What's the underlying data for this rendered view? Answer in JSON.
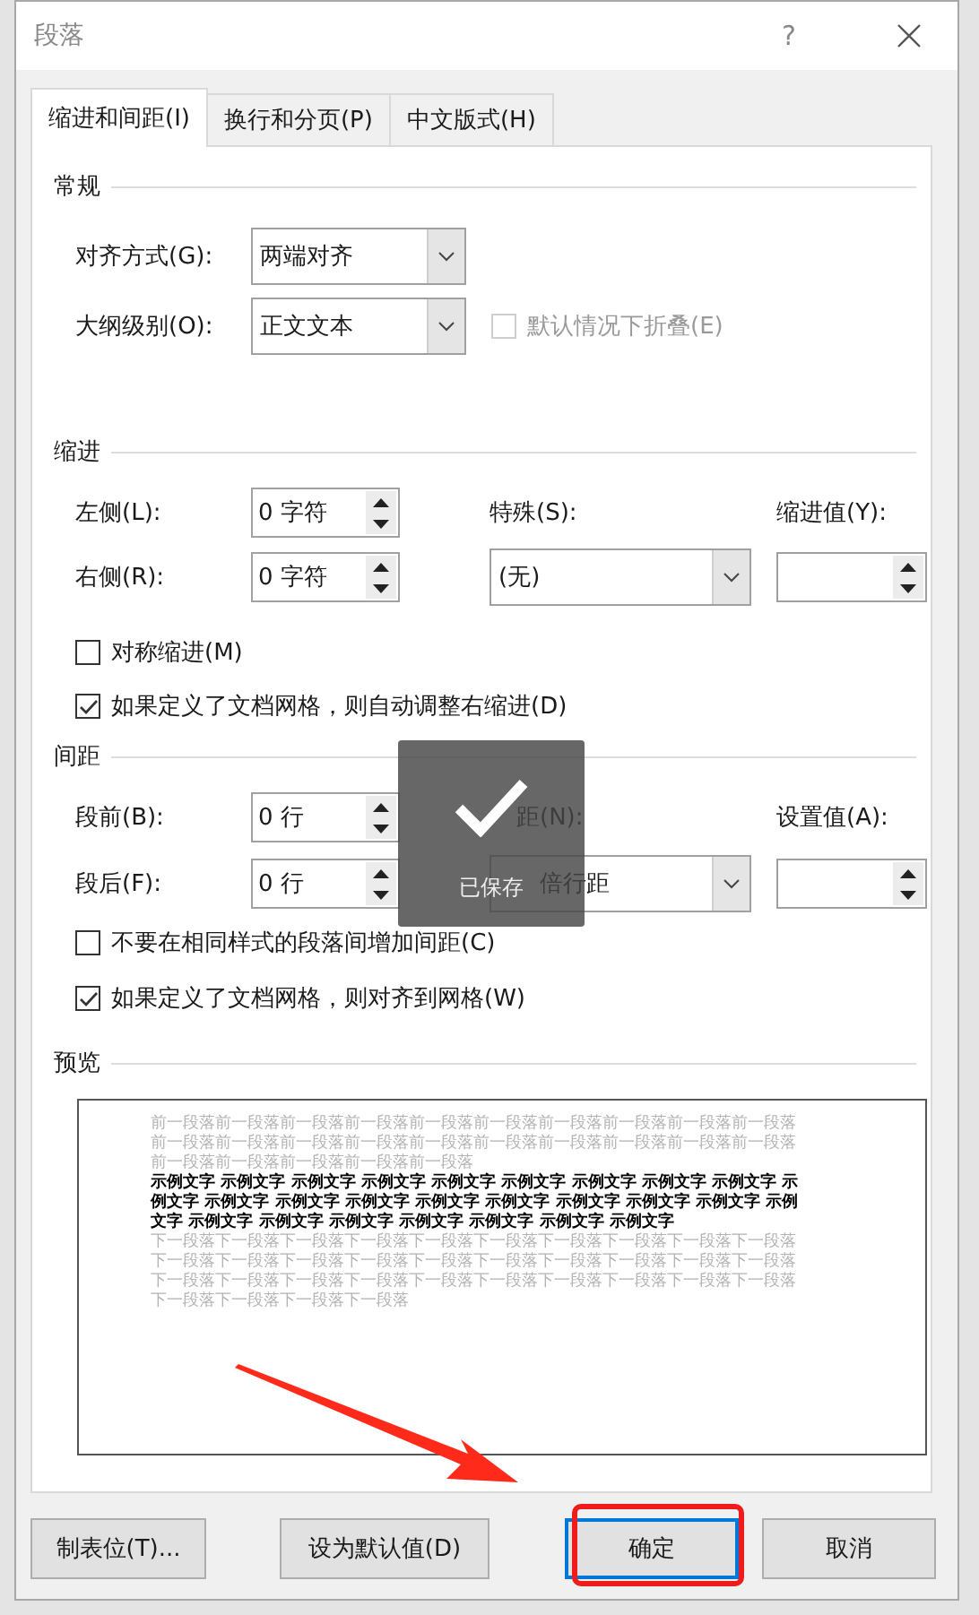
{
  "dialog": {
    "title": "段落",
    "help": "?"
  },
  "tabs": [
    {
      "label": "缩进和间距(I)",
      "selected": true
    },
    {
      "label": "换行和分页(P)",
      "selected": false
    },
    {
      "label": "中文版式(H)",
      "selected": false
    }
  ],
  "general": {
    "heading": "常规",
    "alignment": {
      "label": "对齐方式(G):",
      "value": "两端对齐"
    },
    "outline_level": {
      "label": "大纲级别(O):",
      "value": "正文文本"
    },
    "collapse": {
      "label": "默认情况下折叠(E)",
      "checked": false,
      "disabled": true
    }
  },
  "indent": {
    "heading": "缩进",
    "left": {
      "label": "左侧(L):",
      "value": "0 字符"
    },
    "right": {
      "label": "右侧(R):",
      "value": "0 字符"
    },
    "special": {
      "label": "特殊(S):",
      "value": "(无)"
    },
    "by": {
      "label": "缩进值(Y):"
    },
    "checkboxes": [
      {
        "label": "对称缩进(M)",
        "checked": false
      },
      {
        "label": "如果定义了文档网格，则自动调整右缩进(D)",
        "checked": true
      }
    ]
  },
  "spacing": {
    "heading": "间距",
    "before": {
      "label": "段前(B):",
      "value": "0 行"
    },
    "after": {
      "label": "段后(F):",
      "value": "0 行"
    },
    "line_spacing": {
      "label": "距(N):",
      "value": "倍行距"
    },
    "at": {
      "label": "设置值(A):"
    },
    "checkboxes": [
      {
        "label": "不要在相同样式的段落间增加间距(C)",
        "checked": false
      },
      {
        "label": "如果定义了文档网格，则对齐到网格(W)",
        "checked": true
      }
    ]
  },
  "preview": {
    "heading": "预览",
    "previous_text": "前一段落前一段落前一段落前一段落前一段落前一段落前一段落前一段落前一段落前一段落前一段落前一段落前一段落前一段落前一段落前一段落前一段落前一段落前一段落前一段落前一段落前一段落前一段落前一段落前一段落",
    "sample_text": "示例文字 示例文字 示例文字 示例文字 示例文字 示例文字 示例文字 示例文字 示例文字 示例文字 示例文字 示例文字 示例文字 示例文字 示例文字 示例文字 示例文字 示例文字 示例文字 示例文字 示例文字 示例文字 示例文字 示例文字 示例文字 示例文字",
    "next_text": "下一段落下一段落下一段落下一段落下一段落下一段落下一段落下一段落下一段落下一段落下一段落下一段落下一段落下一段落下一段落下一段落下一段落下一段落下一段落下一段落下一段落下一段落下一段落下一段落下一段落下一段落下一段落下一段落下一段落下一段落下一段落下一段落下一段落下一段落"
  },
  "buttons": [
    {
      "label": "制表位(T)...",
      "kind": "normal"
    },
    {
      "label": "设为默认值(D)",
      "kind": "normal"
    },
    {
      "label": "确定",
      "kind": "default"
    },
    {
      "label": "取消",
      "kind": "normal"
    }
  ],
  "toast": {
    "text": "已保存"
  }
}
